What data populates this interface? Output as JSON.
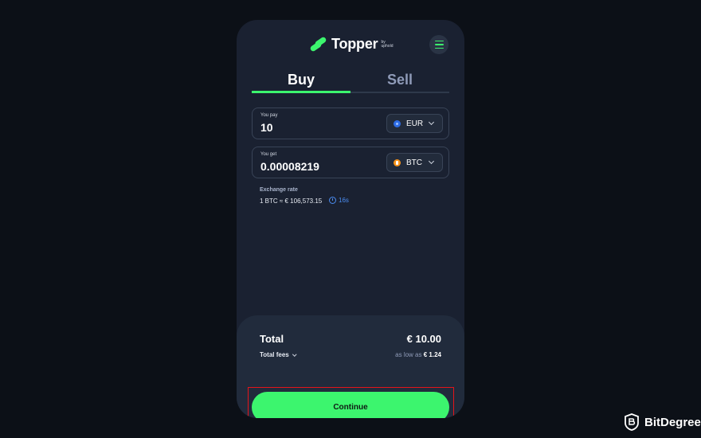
{
  "widget": {
    "brand": "Topper",
    "brand_by": "by",
    "brand_parent": "uphold",
    "tabs": [
      {
        "label": "Buy",
        "active": true
      },
      {
        "label": "Sell",
        "active": false
      }
    ],
    "pay": {
      "label": "You pay",
      "value": "10",
      "currency": "EUR"
    },
    "get": {
      "label": "You get",
      "value": "0.00008219",
      "currency": "BTC"
    },
    "exchange_rate": {
      "label": "Exchange rate",
      "value": "1 BTC ≈ € 106,573.15",
      "timer": "16s"
    },
    "total": {
      "label": "Total",
      "value": "€ 10.00",
      "fees_label": "Total fees",
      "fees_prefix": "as low as",
      "fees_value": "€ 1.24"
    },
    "continue_label": "Continue"
  },
  "watermark": {
    "text": "BitDegree"
  },
  "colors": {
    "accent": "#3cf56e",
    "panel": "#1a2131",
    "background": "#0c1017",
    "highlight_border": "#e4141a"
  },
  "icons": [
    "topper-logo-icon",
    "menu-icon",
    "eur-coin-icon",
    "btc-coin-icon",
    "chevron-down-icon",
    "timer-icon",
    "bitdegree-shield-icon"
  ]
}
